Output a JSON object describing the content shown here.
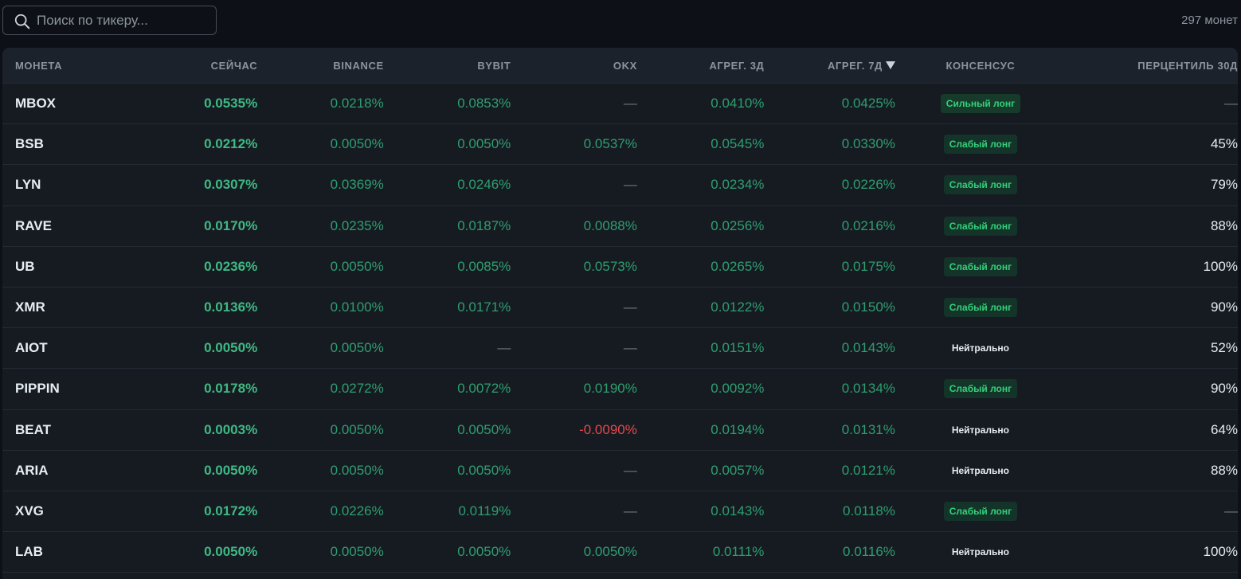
{
  "search": {
    "placeholder": "Поиск по тикеру..."
  },
  "coin_count": "297 монет",
  "columns": [
    "МОНЕТА",
    "СЕЙЧАС",
    "BINANCE",
    "BYBIT",
    "OKX",
    "АГРЕГ. 3Д",
    "АГРЕГ. 7Д",
    "КОНСЕНСУС",
    "ПЕРЦЕНТИЛЬ 30Д"
  ],
  "sorted_column": "АГРЕГ. 7Д",
  "sort_direction": "desc",
  "colors": {
    "positive": "#2e9e6f",
    "negative": "#e5484d",
    "badge_text": "#33d17a",
    "background": "#0d1117"
  },
  "rows": [
    {
      "coin": "MBOX",
      "now": "0.0535%",
      "binance": "0.0218%",
      "bybit": "0.0853%",
      "okx": "—",
      "agg3": "0.0410%",
      "agg7": "0.0425%",
      "consensus": "Сильный лонг",
      "consensus_type": "strong",
      "pct30": "—"
    },
    {
      "coin": "BSB",
      "now": "0.0212%",
      "binance": "0.0050%",
      "bybit": "0.0050%",
      "okx": "0.0537%",
      "agg3": "0.0545%",
      "agg7": "0.0330%",
      "consensus": "Слабый лонг",
      "consensus_type": "weak",
      "pct30": "45%"
    },
    {
      "coin": "LYN",
      "now": "0.0307%",
      "binance": "0.0369%",
      "bybit": "0.0246%",
      "okx": "—",
      "agg3": "0.0234%",
      "agg7": "0.0226%",
      "consensus": "Слабый лонг",
      "consensus_type": "weak",
      "pct30": "79%"
    },
    {
      "coin": "RAVE",
      "now": "0.0170%",
      "binance": "0.0235%",
      "bybit": "0.0187%",
      "okx": "0.0088%",
      "agg3": "0.0256%",
      "agg7": "0.0216%",
      "consensus": "Слабый лонг",
      "consensus_type": "weak",
      "pct30": "88%"
    },
    {
      "coin": "UB",
      "now": "0.0236%",
      "binance": "0.0050%",
      "bybit": "0.0085%",
      "okx": "0.0573%",
      "agg3": "0.0265%",
      "agg7": "0.0175%",
      "consensus": "Слабый лонг",
      "consensus_type": "weak",
      "pct30": "100%"
    },
    {
      "coin": "XMR",
      "now": "0.0136%",
      "binance": "0.0100%",
      "bybit": "0.0171%",
      "okx": "—",
      "agg3": "0.0122%",
      "agg7": "0.0150%",
      "consensus": "Слабый лонг",
      "consensus_type": "weak",
      "pct30": "90%"
    },
    {
      "coin": "AIOT",
      "now": "0.0050%",
      "binance": "0.0050%",
      "bybit": "—",
      "okx": "—",
      "agg3": "0.0151%",
      "agg7": "0.0143%",
      "consensus": "Нейтрально",
      "consensus_type": "neutral",
      "pct30": "52%"
    },
    {
      "coin": "PIPPIN",
      "now": "0.0178%",
      "binance": "0.0272%",
      "bybit": "0.0072%",
      "okx": "0.0190%",
      "agg3": "0.0092%",
      "agg7": "0.0134%",
      "consensus": "Слабый лонг",
      "consensus_type": "weak",
      "pct30": "90%"
    },
    {
      "coin": "BEAT",
      "now": "0.0003%",
      "binance": "0.0050%",
      "bybit": "0.0050%",
      "okx": "-0.0090%",
      "agg3": "0.0194%",
      "agg7": "0.0131%",
      "consensus": "Нейтрально",
      "consensus_type": "neutral",
      "pct30": "64%"
    },
    {
      "coin": "ARIA",
      "now": "0.0050%",
      "binance": "0.0050%",
      "bybit": "0.0050%",
      "okx": "—",
      "agg3": "0.0057%",
      "agg7": "0.0121%",
      "consensus": "Нейтрально",
      "consensus_type": "neutral",
      "pct30": "88%"
    },
    {
      "coin": "XVG",
      "now": "0.0172%",
      "binance": "0.0226%",
      "bybit": "0.0119%",
      "okx": "—",
      "agg3": "0.0143%",
      "agg7": "0.0118%",
      "consensus": "Слабый лонг",
      "consensus_type": "weak",
      "pct30": "—"
    },
    {
      "coin": "LAB",
      "now": "0.0050%",
      "binance": "0.0050%",
      "bybit": "0.0050%",
      "okx": "0.0050%",
      "agg3": "0.0111%",
      "agg7": "0.0116%",
      "consensus": "Нейтрально",
      "consensus_type": "neutral",
      "pct30": "100%"
    }
  ]
}
